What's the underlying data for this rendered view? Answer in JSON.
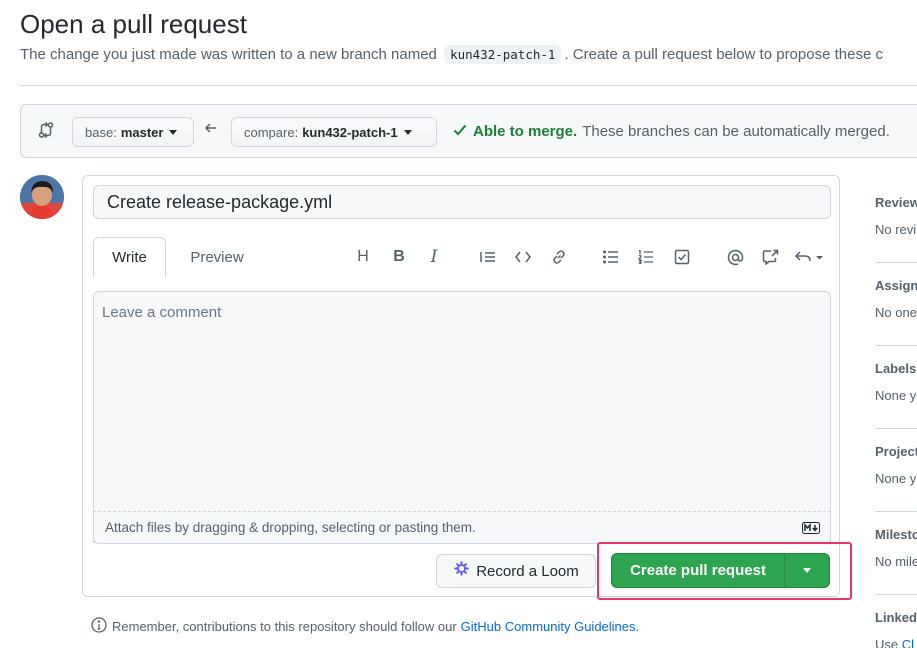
{
  "header": {
    "title": "Open a pull request",
    "subtitle_pre": "The change you just made was written to a new branch named",
    "branch_code": "kun432-patch-1",
    "subtitle_post": ". Create a pull request below to propose these c"
  },
  "compare": {
    "base_label": "base:",
    "base_value": "master",
    "compare_label": "compare:",
    "compare_value": "kun432-patch-1",
    "merge_ok": "Able to merge.",
    "merge_msg": "These branches can be automatically merged."
  },
  "form": {
    "title_value": "Create release-package.yml",
    "tab_write": "Write",
    "tab_preview": "Preview",
    "toolbar": {
      "heading": "H",
      "bold": "B",
      "italic": "I"
    },
    "comment_placeholder": "Leave a comment",
    "attach_text": "Attach files by dragging & dropping, selecting or pasting them.",
    "loom_label": "Record a Loom",
    "create_label": "Create pull request"
  },
  "footer": {
    "note": "Remember, contributions to this repository should follow our",
    "link": "GitHub Community Guidelines",
    "period": "."
  },
  "sidebar": {
    "reviewers": {
      "head": "Review",
      "val": "No revi"
    },
    "assignees": {
      "head": "Assign",
      "val": "No one"
    },
    "labels": {
      "head": "Labels",
      "val": "None y"
    },
    "projects": {
      "head": "Project",
      "val": "None y"
    },
    "milestone": {
      "head": "Milesto",
      "val": "No mile"
    },
    "linked": {
      "head": "Linked",
      "val_pre": "Use ",
      "val_link": "Cl"
    }
  },
  "colors": {
    "accent_green": "#2da44e",
    "merge_green": "#1a7f37",
    "link_blue": "#0969da",
    "highlight": "#e8336b"
  }
}
